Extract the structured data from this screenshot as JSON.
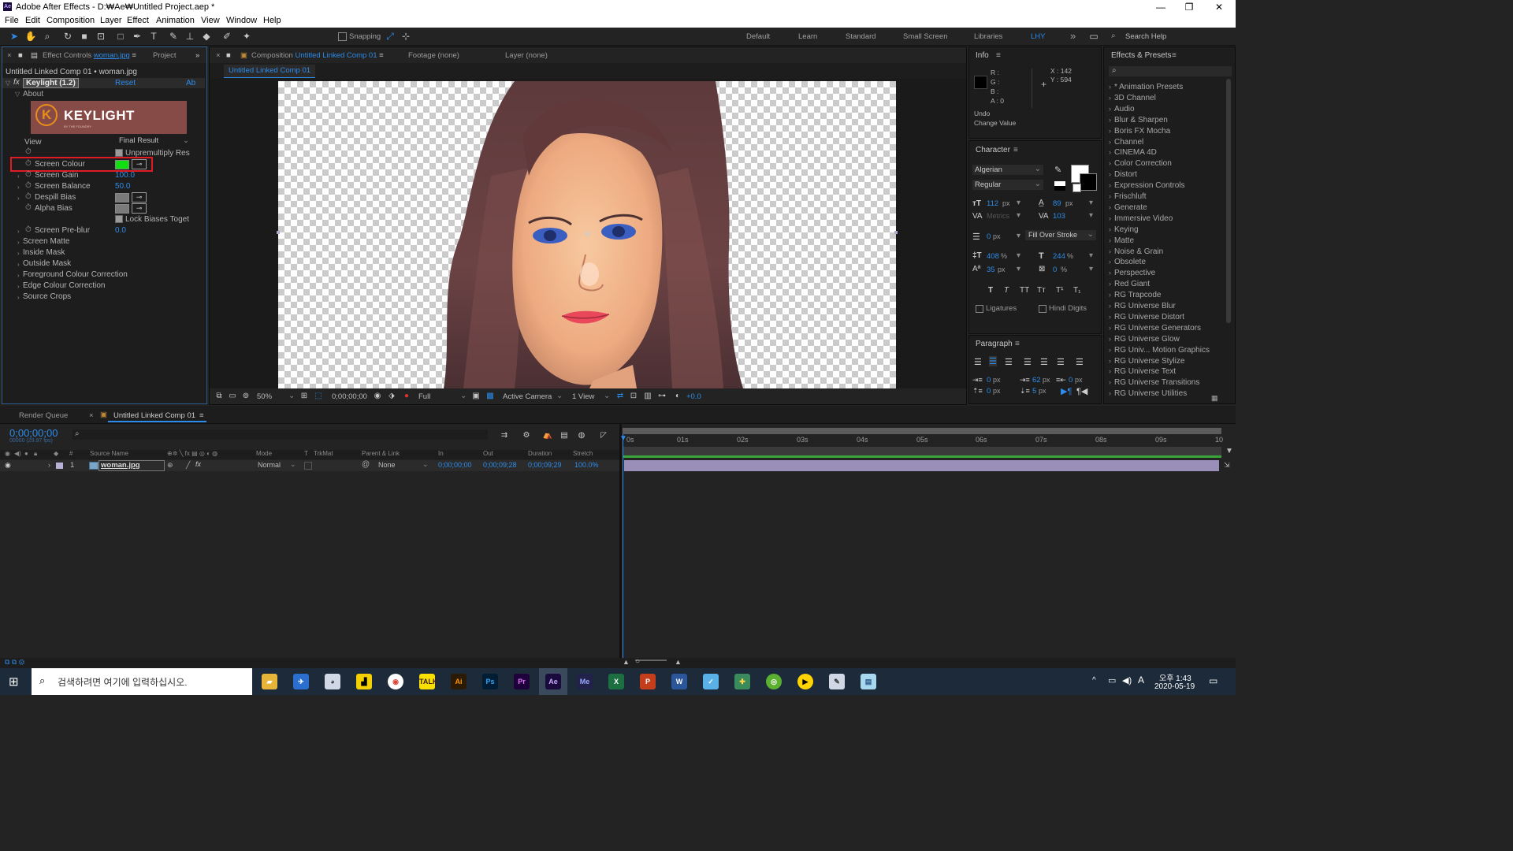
{
  "window": {
    "title": "Adobe After Effects - D:₩Ae₩Untitled Project.aep *",
    "minimize": "—",
    "maximize": "❐",
    "close": "✕"
  },
  "menu": [
    "File",
    "Edit",
    "Composition",
    "Layer",
    "Effect",
    "Animation",
    "View",
    "Window",
    "Help"
  ],
  "toolbar": {
    "snapping_label": "Snapping",
    "workspaces": [
      "Default",
      "Learn",
      "Standard",
      "Small Screen",
      "Libraries",
      "LHY"
    ],
    "more": "»",
    "search_help_placeholder": "Search Help"
  },
  "effect_controls": {
    "tab_prefix": "Effect Controls",
    "tab_layer": "woman.jpg",
    "tab_project": "Project",
    "breadcrumb": "Untitled Linked Comp 01 • woman.jpg",
    "effect_name": "Keylight (1.2)",
    "reset_label": "Reset",
    "about_btn": "Ab",
    "about_label": "About",
    "logo_text": "KEYLIGHT",
    "logo_sub": "BY THE FOUNDRY",
    "view_label": "View",
    "view_value": "Final Result",
    "unpremultiply_label": "Unpremultiply Res",
    "screen_colour_label": "Screen Colour",
    "screen_gain_label": "Screen Gain",
    "screen_gain_value": "100.0",
    "screen_balance_label": "Screen Balance",
    "screen_balance_value": "50.0",
    "despill_label": "Despill Bias",
    "alpha_label": "Alpha Bias",
    "lock_biases_label": "Lock Biases Toget",
    "preblur_label": "Screen Pre-blur",
    "preblur_value": "0.0",
    "groups": [
      "Screen Matte",
      "Inside Mask",
      "Outside Mask",
      "Foreground Colour Correction",
      "Edge Colour Correction",
      "Source Crops"
    ],
    "screen_colour_hex": "#10e010",
    "highlight_color": "#e01b24"
  },
  "composition": {
    "tab_prefix": "Composition",
    "tab_name": "Untitled Linked Comp 01",
    "footage_tab": "Footage (none)",
    "layer_tab": "Layer (none)",
    "subtab": "Untitled Linked Comp 01",
    "zoom": "50%",
    "timecode": "0;00;00;00",
    "resolution": "Full",
    "camera": "Active Camera",
    "views": "1 View",
    "exposure": "+0.0"
  },
  "info": {
    "title": "Info",
    "r": "R :",
    "g": "G :",
    "b": "B :",
    "a": "A :  0",
    "x": "X : 142",
    "y": "Y : 594",
    "undo": "Undo",
    "undo_value": "Change Value"
  },
  "character": {
    "title": "Character",
    "font": "Algerian",
    "style": "Regular",
    "size": "112",
    "size_unit": "px",
    "leading": "89",
    "leading_unit": "px",
    "kerning": "Metrics",
    "tracking": "103",
    "stroke_width": "0",
    "stroke_unit": "px",
    "stroke_mode": "Fill Over Stroke",
    "vscale": "408",
    "hscale": "244",
    "pct": "%",
    "baseline": "35",
    "baseline_unit": "px",
    "tsume": "0",
    "tsume_unit": "%",
    "styles": [
      "T",
      "T",
      "TT",
      "Tт",
      "T¹",
      "T₁"
    ],
    "ligatures_label": "Ligatures",
    "hindi_label": "Hindi Digits"
  },
  "paragraph": {
    "title": "Paragraph",
    "indent_left": "0",
    "indent_first": "62",
    "indent_right": "0",
    "space_before": "0",
    "space_after": "5",
    "unit": "px"
  },
  "effects_presets": {
    "title": "Effects & Presets",
    "items": [
      "* Animation Presets",
      "3D Channel",
      "Audio",
      "Blur & Sharpen",
      "Boris FX Mocha",
      "Channel",
      "CINEMA 4D",
      "Color Correction",
      "Distort",
      "Expression Controls",
      "Frischluft",
      "Generate",
      "Immersive Video",
      "Keying",
      "Matte",
      "Noise & Grain",
      "Obsolete",
      "Perspective",
      "Red Giant",
      "RG Trapcode",
      "RG Universe Blur",
      "RG Universe Distort",
      "RG Universe Generators",
      "RG Universe Glow",
      "RG Univ... Motion Graphics",
      "RG Universe Stylize",
      "RG Universe Text",
      "RG Universe Transitions",
      "RG Universe Utilities"
    ]
  },
  "timeline": {
    "render_queue_tab": "Render Queue",
    "comp_tab": "Untitled Linked Comp 01",
    "timecode": "0;00;00;00",
    "frame_info": "00000 (29.97 fps)",
    "headers": {
      "source_name": "Source Name",
      "mode": "Mode",
      "t": "T",
      "trkmat": "TrkMat",
      "parent": "Parent & Link",
      "in": "In",
      "out": "Out",
      "duration": "Duration",
      "stretch": "Stretch",
      "hash": "#"
    },
    "ruler": [
      "0s",
      "01s",
      "02s",
      "03s",
      "04s",
      "05s",
      "06s",
      "07s",
      "08s",
      "09s",
      "10"
    ],
    "layer": {
      "index": "1",
      "name": "woman.jpg",
      "mode": "Normal",
      "parent": "None",
      "in": "0;00;00;00",
      "out": "0;00;09;28",
      "duration": "0;00;09;29",
      "stretch": "100.0%"
    }
  },
  "taskbar": {
    "search_placeholder": "검색하려면 여기에 입력하십시오.",
    "time": "오후 1:43",
    "date": "2020-05-19",
    "ime": "A"
  }
}
